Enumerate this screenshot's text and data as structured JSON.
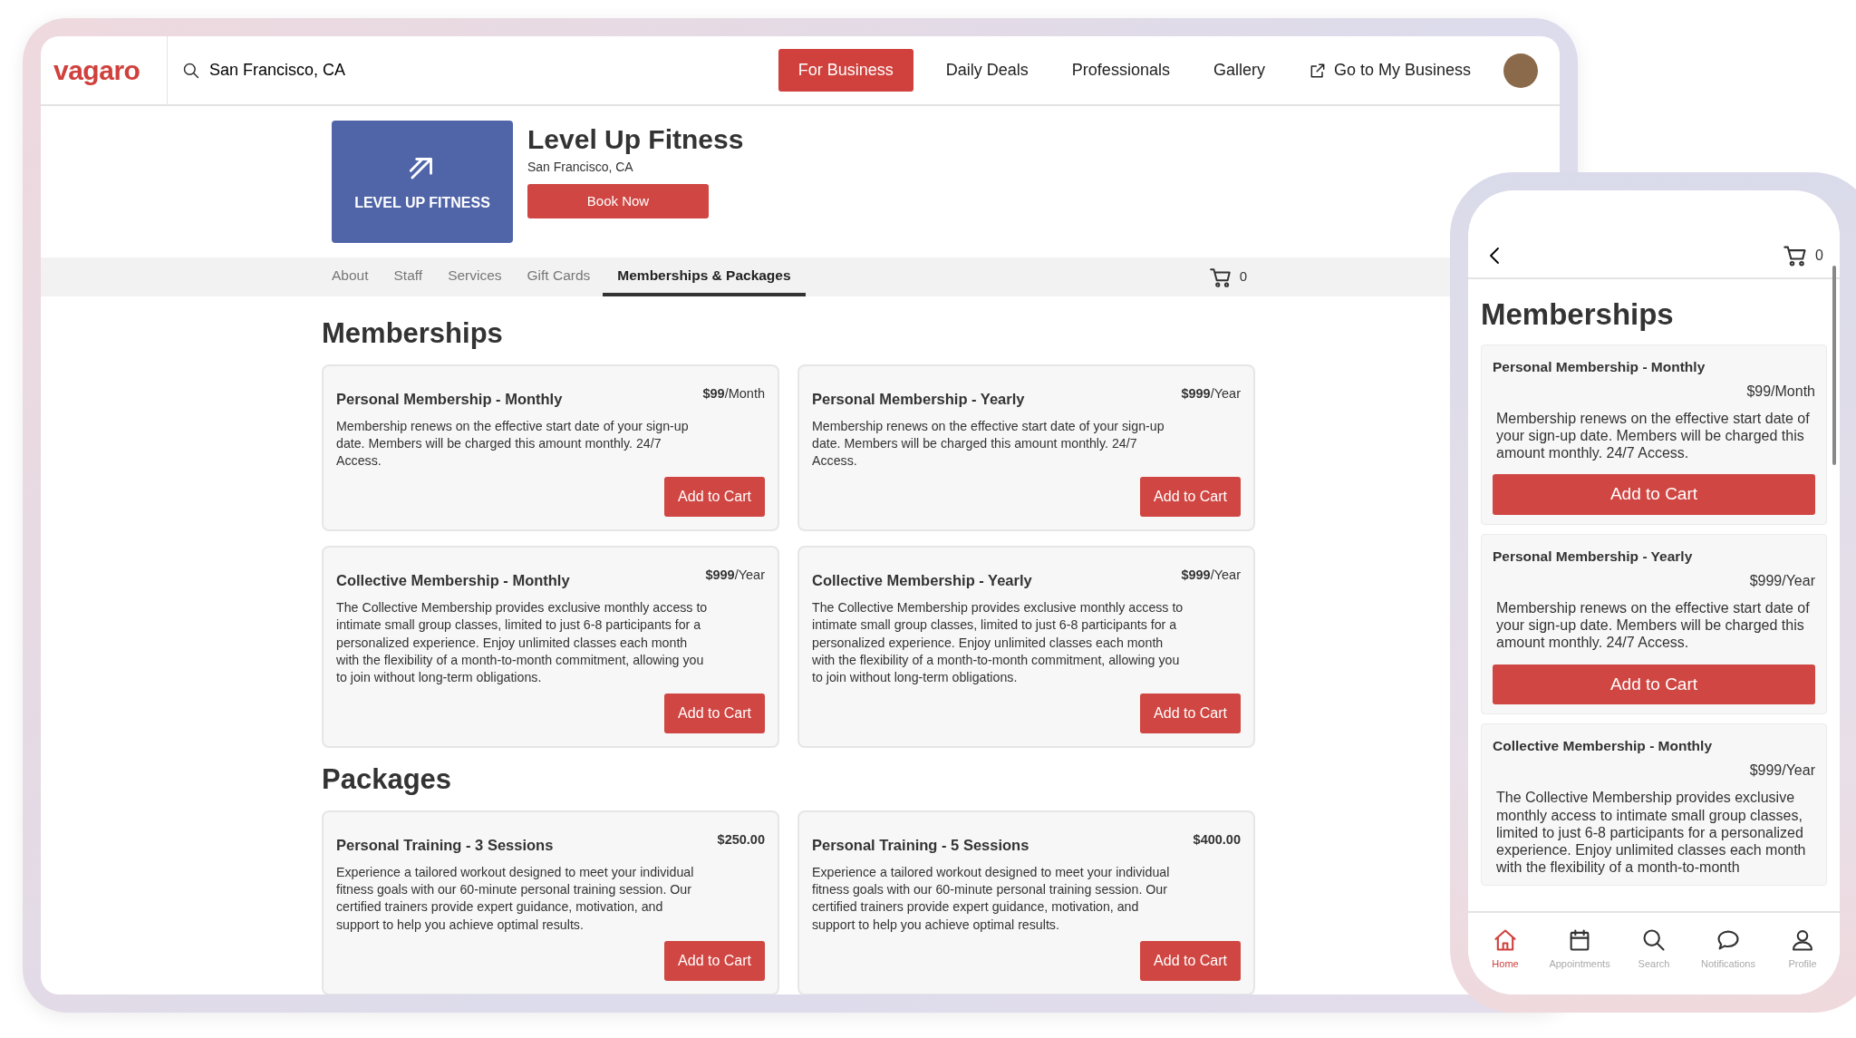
{
  "tablet": {
    "header": {
      "logo": "vagaro",
      "search": {
        "value": "San Francisco, CA"
      },
      "nav": [
        {
          "label": "For Business",
          "kind": "primary"
        },
        {
          "label": "Daily Deals",
          "kind": "link"
        },
        {
          "label": "Professionals",
          "kind": "link"
        },
        {
          "label": "Gallery",
          "kind": "link"
        },
        {
          "label": "Go to My Business",
          "kind": "external"
        }
      ]
    },
    "business": {
      "logo_text": "LEVEL UP FITNESS",
      "name": "Level Up Fitness",
      "location": "San Francisco, CA",
      "book_button": "Book Now"
    },
    "tabs": [
      {
        "label": "About",
        "selected": false
      },
      {
        "label": "Staff",
        "selected": false
      },
      {
        "label": "Services",
        "selected": false
      },
      {
        "label": "Gift Cards",
        "selected": false
      },
      {
        "label": "Memberships & Packages",
        "selected": true
      }
    ],
    "cart_count": "0",
    "sections": [
      {
        "title": "Memberships",
        "kind": "memberships",
        "items": [
          {
            "name": "Personal Membership - Monthly",
            "price": "**$99**/Month",
            "description": "Membership renews on the effective start date of your sign-up date. Members will be charged this amount monthly. 24/7 Access.",
            "button": "Add to Cart"
          },
          {
            "name": "Personal Membership - Yearly",
            "price": "**$999**/Year",
            "description": "Membership renews on the effective start date of your sign-up date. Members will be charged this amount monthly. 24/7 Access.",
            "button": "Add to Cart"
          },
          {
            "name": "Collective Membership - Monthly",
            "price": "**$999**/Year",
            "description": "The Collective Membership provides exclusive monthly access to intimate small group classes, limited to just 6-8 participants for a personalized experience. Enjoy unlimited classes each month with the flexibility of a month-to-month commitment, allowing you to join without long-term obligations.",
            "button": "Add to Cart"
          },
          {
            "name": "Collective Membership - Yearly",
            "price": "**$999**/Year",
            "description": "The Collective Membership provides exclusive monthly access to intimate small group classes, limited to just 6-8 participants for a personalized experience. Enjoy unlimited classes each month with the flexibility of a month-to-month commitment, allowing you to join without long-term obligations.",
            "button": "Add to Cart"
          }
        ]
      },
      {
        "title": "Packages",
        "kind": "packages",
        "items": [
          {
            "name": "Personal Training - 3 Sessions",
            "price": "$250.00",
            "description": "Experience a tailored workout designed to meet your individual fitness goals with our 60-minute personal training session. Our certified trainers provide expert guidance, motivation, and support to help you achieve optimal results.",
            "button": "Add to Cart"
          },
          {
            "name": "Personal Training - 5 Sessions",
            "price": "$400.00",
            "description": "Experience a tailored workout designed to meet your individual fitness goals with our 60-minute personal training session. Our certified trainers provide expert guidance, motivation, and support to help you achieve optimal results.",
            "button": "Add to Cart"
          }
        ]
      }
    ]
  },
  "phone": {
    "cart_count": "0",
    "title": "Memberships",
    "items": [
      {
        "name": "Personal Membership - Monthly",
        "price": "$99/Month",
        "description": "Membership renews on the effective start date of your sign-up date. Members will be charged this amount monthly. 24/7 Access.",
        "button": "Add to Cart"
      },
      {
        "name": "Personal Membership - Yearly",
        "price": "$999/Year",
        "description": "Membership renews on the effective start date of your sign-up date. Members will be charged this amount monthly. 24/7 Access.",
        "button": "Add to Cart"
      },
      {
        "name": "Collective Membership - Monthly",
        "price": "$999/Year",
        "description": "The Collective Membership provides exclusive monthly access to intimate small group classes, limited to just 6-8 participants for a personalized experience. Enjoy unlimited classes each month with the flexibility of a month-to-month"
      }
    ],
    "bottom_nav": [
      {
        "label": "Home",
        "kind": "home",
        "selected": true
      },
      {
        "label": "Appointments",
        "kind": "calendar",
        "selected": false
      },
      {
        "label": "Search",
        "kind": "search",
        "selected": false
      },
      {
        "label": "Notifications",
        "kind": "chat",
        "selected": false
      },
      {
        "label": "Profile",
        "kind": "person",
        "selected": false
      }
    ]
  }
}
